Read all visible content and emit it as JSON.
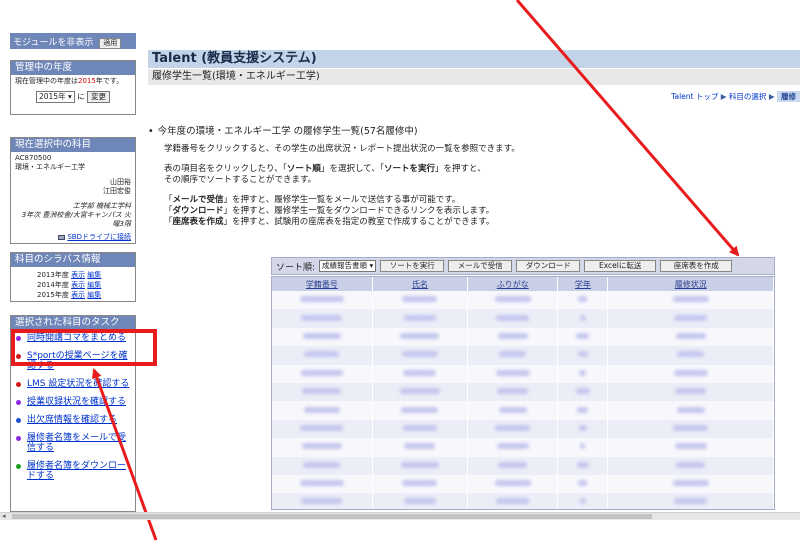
{
  "sidebar": {
    "module_toggle": {
      "label": "モジュールを非表示",
      "apply_label": "適用"
    },
    "year_box": {
      "title": "管理中の年度",
      "current_prefix": "現在管理中の年度は",
      "current_year": "2015",
      "current_suffix": "年です。",
      "selected_year": "2015年",
      "suffix": "に",
      "change_label": "変更"
    },
    "course_box": {
      "title": "現在選択中の科目",
      "code": "AC870500",
      "name": "環境・エネルギー工学",
      "teacher1": "山田裕",
      "teacher2": "江田宏俊",
      "dept1": "工学部 機械工学科",
      "dept2": "3年次 豊洲校舎/大宮キャンパス 火曜3限",
      "drive_link": "SBDドライブに接続"
    },
    "syllabus_box": {
      "title": "科目のシラバス情報",
      "rows": [
        {
          "year": "2013年度",
          "view": "表示",
          "edit": "編集"
        },
        {
          "year": "2014年度",
          "view": "表示",
          "edit": "編集"
        },
        {
          "year": "2015年度",
          "view": "表示",
          "edit": "編集"
        }
      ]
    },
    "tasks_box": {
      "title": "選択された科目のタスク",
      "items": [
        {
          "label": "同時開講コマをまとめる",
          "color": "#8a2be2"
        },
        {
          "label": "S*portの授業ページを確認する",
          "color": "#d01a1a"
        },
        {
          "label": "LMS 設定状況を確認する",
          "color": "#d01a1a"
        },
        {
          "label": "授業収録状況を確認する",
          "color": "#8a2be2"
        },
        {
          "label": "出欠席情報を確認する",
          "color": "#1a4fd0"
        },
        {
          "label": "履修者名簿をメールで受信する",
          "color": "#8a2be2"
        },
        {
          "label": "履修者名簿をダウンロードする",
          "color": "#1aa01a"
        }
      ]
    }
  },
  "header": {
    "title": "Talent (教員支援システム)",
    "subtitle": "履修学生一覧(環境・エネルギー工学)"
  },
  "breadcrumb": {
    "items": [
      "Talent トップ",
      "科目の選択"
    ],
    "separator": "▶",
    "active": "履修"
  },
  "main": {
    "section_title": "今年度の環境・エネルギー工学 の履修学生一覧",
    "section_count": "(57名履修中)",
    "desc1": "学籍番号をクリックすると、その学生の出席状況・レポート提出状況の一覧を参照できます。",
    "desc2a_1": "表の項目名をクリックしたり、「",
    "desc2a_b1": "ソート順",
    "desc2a_2": "」を選択して、「",
    "desc2a_b2": "ソートを実行",
    "desc2a_3": "」を押すと、",
    "desc2b": "その順序でソートすることができます。",
    "desc3_1": "「",
    "desc3_b": "メールで受信",
    "desc3_2": "」を押すと、履修学生一覧をメールで送信する事が可能です。",
    "desc4_1": "「",
    "desc4_b": "ダウンロード",
    "desc4_2": "」を押すと、履修学生一覧をダウンロードできるリンクを表示します。",
    "desc5_1": "「",
    "desc5_b": "座席表を作成",
    "desc5_2": "」を押すと、試験用の座席表を指定の教室で作成することができます。"
  },
  "toolbar": {
    "sort_label": "ソート順:",
    "sort_value": "成績報告書順",
    "buttons": [
      "ソートを実行",
      "メールで受信",
      "ダウンロード",
      "Excelに転送",
      "座席表を作成"
    ]
  },
  "table": {
    "columns": [
      "学籍番号",
      "氏名",
      "ふりがな",
      "学年",
      "履修状況"
    ]
  },
  "colors": {
    "header_bg": "#c4d4e8",
    "sidebar_head": "#6f86b8",
    "annotation": "#e81c1c"
  }
}
